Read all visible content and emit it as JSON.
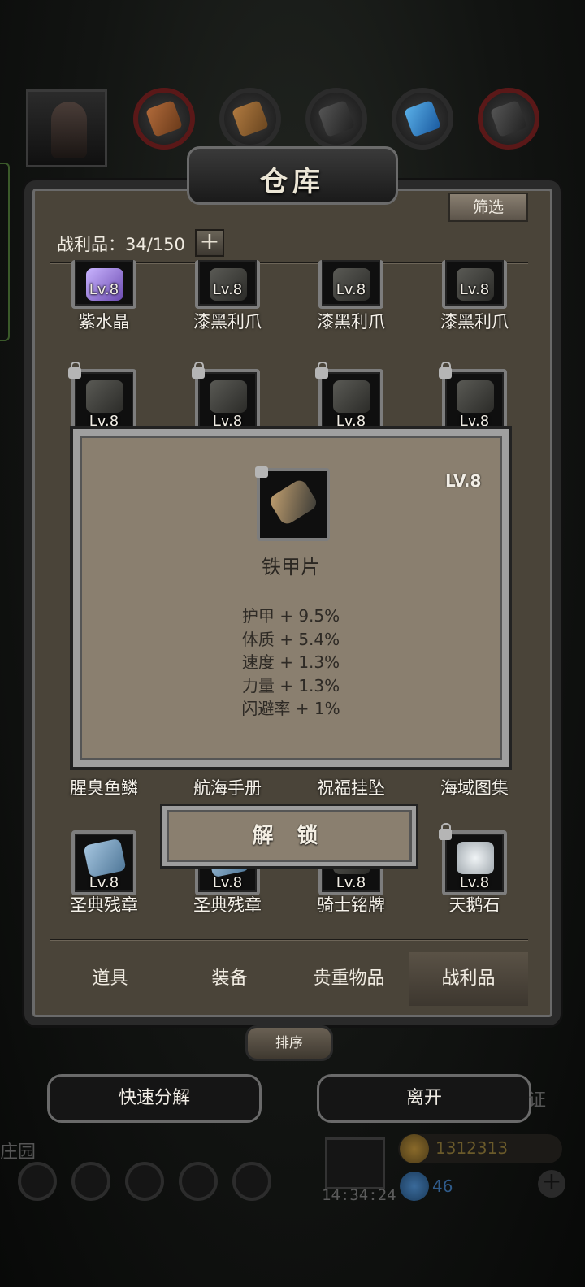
{
  "panel": {
    "title": "仓库",
    "filter_label": "筛选",
    "loot_count": "战利品：34/150",
    "add_label": "+"
  },
  "grid": {
    "row1": [
      {
        "level": "Lv.8",
        "name": "紫水晶",
        "icon": "amethyst-icon"
      },
      {
        "level": "Lv.8",
        "name": "漆黑利爪",
        "icon": "claw-icon"
      },
      {
        "level": "Lv.8",
        "name": "漆黑利爪",
        "icon": "claw-icon"
      },
      {
        "level": "Lv.8",
        "name": "漆黑利爪",
        "icon": "claw-icon"
      }
    ],
    "row2": [
      {
        "level": "Lv.8",
        "icon": "claw-icon",
        "locked": true
      },
      {
        "level": "Lv.8",
        "icon": "claw-icon",
        "locked": true
      },
      {
        "level": "Lv.8",
        "icon": "claw-icon",
        "locked": true
      },
      {
        "level": "Lv.8",
        "icon": "claw-icon",
        "locked": true
      }
    ],
    "row3_names": [
      "腥臭鱼鳞",
      "航海手册",
      "祝福挂坠",
      "海域图集"
    ],
    "row4": [
      {
        "level": "Lv.8",
        "name": "圣典残章",
        "icon": "book-icon"
      },
      {
        "level": "Lv.8",
        "name": "圣典残章",
        "icon": "book-icon"
      },
      {
        "level": "Lv.8",
        "name": "骑士铭牌",
        "icon": "badge-icon"
      },
      {
        "level": "Lv.8",
        "name": "天鹅石",
        "icon": "stone-icon",
        "locked": true
      }
    ]
  },
  "tabs": [
    "道具",
    "装备",
    "贵重物品",
    "战利品"
  ],
  "active_tab": "战利品",
  "sort_label": "排序",
  "quick_decompose_label": "快速分解",
  "leave_label": "离开",
  "popup": {
    "level": "LV.8",
    "name": "铁甲片",
    "stats": [
      "护甲 + 9.5%",
      "体质 + 5.4%",
      "速度 + 1.3%",
      "力量 + 1.3%",
      "闪避率 + 1%"
    ],
    "unlock_label": "解 锁"
  },
  "hud": {
    "time": "14:34:24",
    "gold": "1312313",
    "gems": "46",
    "left_text": "庄园",
    "right_text": "证"
  },
  "colors": {
    "panel_bg": "#4a4439",
    "popup_bg": "#8a7f6f",
    "text_light": "#f1ece2",
    "text_dark": "#2e2a25"
  }
}
